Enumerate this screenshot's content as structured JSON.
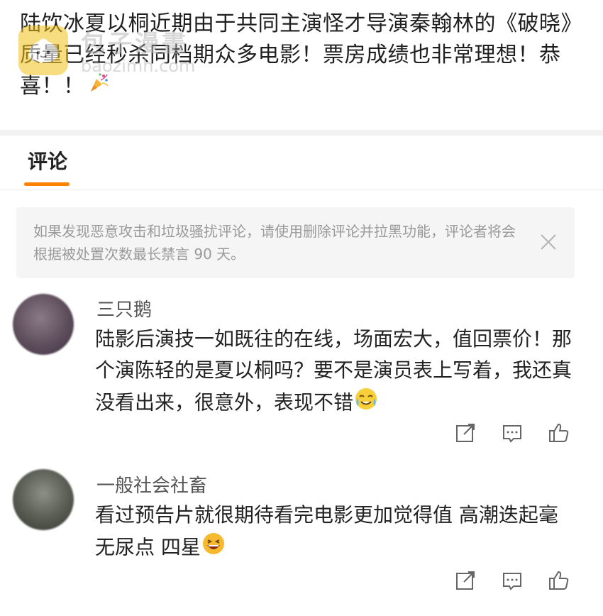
{
  "post": {
    "text": "陆饮冰夏以桐近期由于共同主演怪才导演秦翰林的《破晓》质量已经秒杀同档期众多电影！票房成绩也非常理想！恭喜！！"
  },
  "watermark": {
    "name": "包子漫畫",
    "url": "baozimh.com"
  },
  "tabs": {
    "comments_label": "评论"
  },
  "notice": {
    "text": "如果发现恶意攻击和垃圾骚扰评论，请使用删除评论并拉黑功能，评论者将会根据被处置次数最长禁言 90 天。"
  },
  "comments": [
    {
      "name": "三只鹅",
      "text": "陆影后演技一如既往的在线，场面宏大，值回票价！那个演陈轻的是夏以桐吗？要不是演员表上写着，我还真没看出来，很意外，表现不错",
      "avatar_color": "#6a5a66"
    },
    {
      "name": "一般社会社畜",
      "text": "看过预告片就很期待看完电影更加觉得值 高潮迭起毫无尿点 四星",
      "avatar_color": "#55584f"
    }
  ],
  "icons": {
    "share": "share-icon",
    "comment": "comment-icon",
    "like": "thumbs-up-icon",
    "close": "close-icon",
    "party": "party-popper-icon"
  },
  "colors": {
    "accent": "#ff8200",
    "notice_bg": "#f5f5f5"
  }
}
